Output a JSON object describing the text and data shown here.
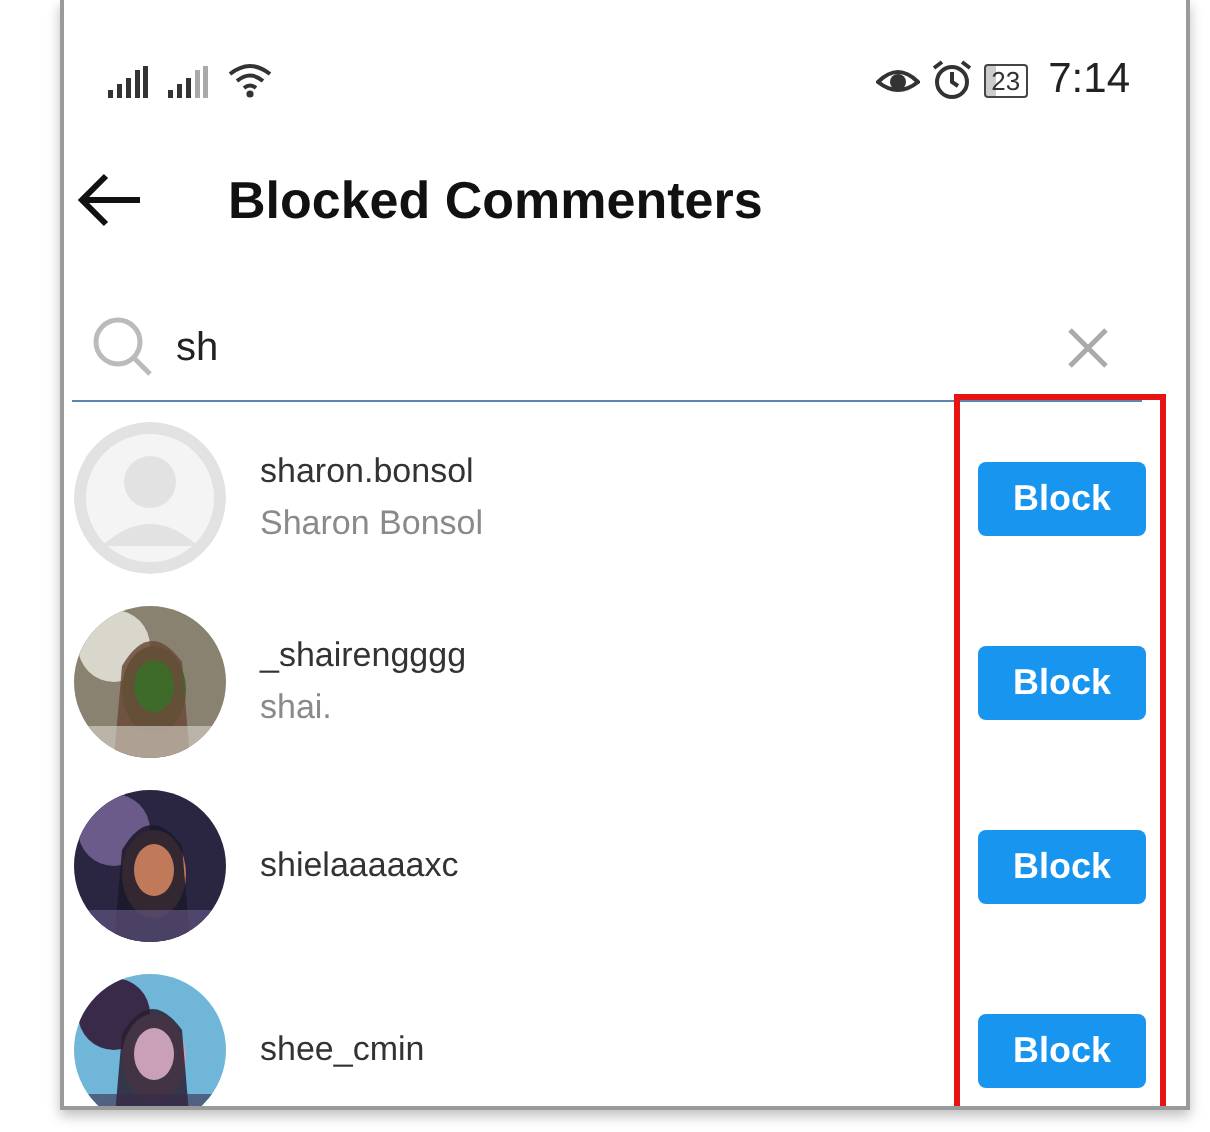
{
  "status_bar": {
    "time": "7:14",
    "battery": "23"
  },
  "header": {
    "title": "Blocked Commenters"
  },
  "search": {
    "value": "sh"
  },
  "users": [
    {
      "username": "sharon.bonsol",
      "full_name": "Sharon Bonsol",
      "avatar": {
        "kind": "default"
      },
      "button": "Block"
    },
    {
      "username": "_shairengggg",
      "full_name": "shai.",
      "button": "Block"
    },
    {
      "username": "shielaaaaaxc",
      "button": "Block"
    },
    {
      "username": "shee_cmin",
      "button": "Block"
    }
  ]
}
